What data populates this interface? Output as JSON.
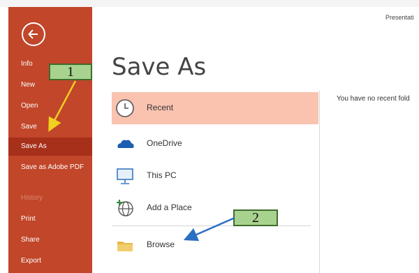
{
  "window": {
    "title": "Presentati"
  },
  "sidebar": {
    "items": [
      {
        "label": "Info"
      },
      {
        "label": "New"
      },
      {
        "label": "Open"
      },
      {
        "label": "Save"
      },
      {
        "label": "Save As"
      },
      {
        "label": "Save as Adobe PDF"
      },
      {
        "label": "History"
      },
      {
        "label": "Print"
      },
      {
        "label": "Share"
      },
      {
        "label": "Export"
      }
    ]
  },
  "main": {
    "heading": "Save As",
    "locations": [
      {
        "label": "Recent",
        "icon": "clock-icon"
      },
      {
        "label": "OneDrive",
        "icon": "cloud-icon"
      },
      {
        "label": "This PC",
        "icon": "computer-icon"
      },
      {
        "label": "Add a Place",
        "icon": "globe-plus-icon"
      },
      {
        "label": "Browse",
        "icon": "folder-icon"
      }
    ],
    "recent_message": "You have no recent fold"
  },
  "annotations": [
    {
      "label": "1",
      "color": "#a8d38f"
    },
    {
      "label": "2",
      "color": "#a8d38f"
    }
  ],
  "colors": {
    "sidebar": "#c1462a",
    "sidebar_selected": "#a6301a",
    "recent_highlight": "#f9c3b0"
  }
}
